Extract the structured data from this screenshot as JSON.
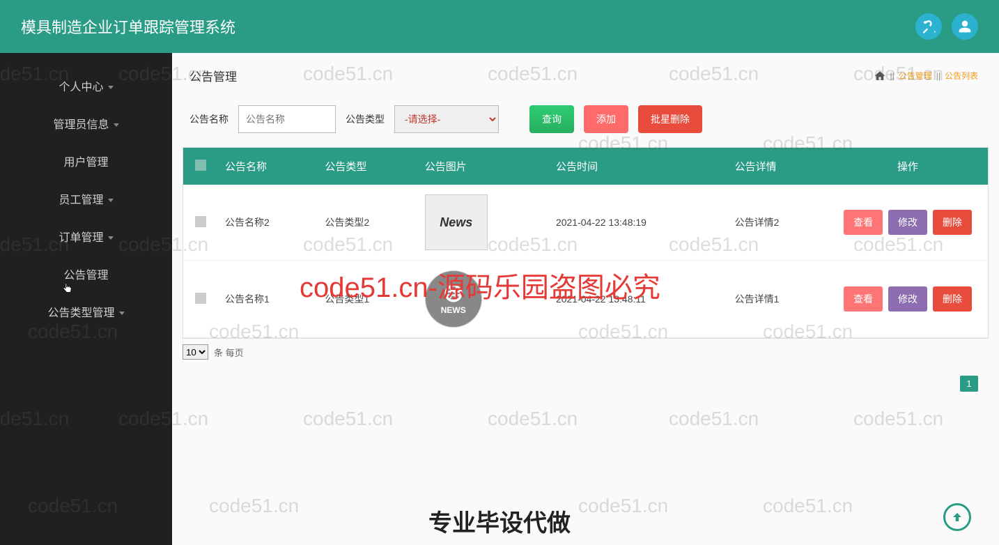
{
  "header": {
    "title": "模具制造企业订单跟踪管理系统"
  },
  "sidebar": {
    "items": [
      {
        "label": "个人中心",
        "caret": true
      },
      {
        "label": "管理员信息",
        "caret": true
      },
      {
        "label": "用户管理",
        "caret": false
      },
      {
        "label": "员工管理",
        "caret": true
      },
      {
        "label": "订单管理",
        "caret": true
      },
      {
        "label": "公告管理",
        "caret": false
      },
      {
        "label": "公告类型管理",
        "caret": true
      }
    ]
  },
  "page": {
    "title": "公告管理"
  },
  "breadcrumb": {
    "sep": "||",
    "link1": "公告管理",
    "link2": "公告列表"
  },
  "filter": {
    "name_label": "公告名称",
    "name_placeholder": "公告名称",
    "type_label": "公告类型",
    "type_placeholder": "-请选择-",
    "search_btn": "查询",
    "add_btn": "添加",
    "batch_delete_btn": "批星删除"
  },
  "table": {
    "headers": {
      "name": "公告名称",
      "type": "公告类型",
      "image": "公告图片",
      "time": "公告时间",
      "detail": "公告详情",
      "action": "操作"
    },
    "rows": [
      {
        "name": "公告名称2",
        "type": "公告类型2",
        "time": "2021-04-22 13:48:19",
        "detail": "公告详情2"
      },
      {
        "name": "公告名称1",
        "type": "公告类型1",
        "time": "2021-04-22 13:48:11",
        "detail": "公告详情1"
      }
    ],
    "actions": {
      "view": "查看",
      "edit": "修改",
      "delete": "删除"
    }
  },
  "pager": {
    "size": "10",
    "text": "条 每页",
    "current": "1"
  },
  "watermark": {
    "text": "code51.cn",
    "red": "code51.cn-源码乐园盗图必究",
    "bottom": "专业毕设代做"
  }
}
